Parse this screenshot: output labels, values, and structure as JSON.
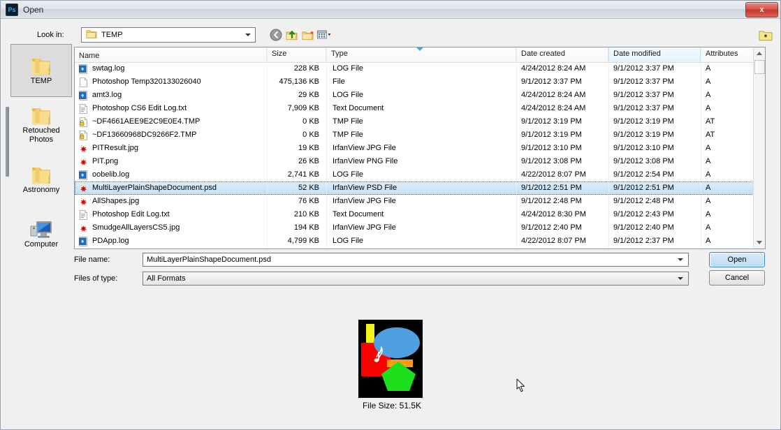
{
  "window": {
    "title": "Open",
    "app_icon": "photoshop-icon",
    "app_icon_text": "Ps",
    "close_label": "x"
  },
  "toolbar": {
    "lookin_label": "Look in:",
    "lookin_value": "TEMP",
    "buttons": [
      {
        "name": "back-button",
        "icon": "back-arrow-icon"
      },
      {
        "name": "up-folder-button",
        "icon": "up-folder-icon"
      },
      {
        "name": "new-folder-button",
        "icon": "new-folder-icon"
      },
      {
        "name": "views-button",
        "icon": "views-icon"
      }
    ],
    "favorites_icon": "favorite-folder-icon"
  },
  "places": {
    "items": [
      {
        "label": "TEMP",
        "icon": "folder-icon",
        "active": true
      },
      {
        "label": "Retouched\nPhotos",
        "icon": "folder-icon",
        "active": false
      },
      {
        "label": "Astronomy",
        "icon": "folder-icon",
        "active": false
      },
      {
        "label": "Computer",
        "icon": "computer-icon",
        "active": false
      }
    ]
  },
  "filelist": {
    "columns": [
      {
        "key": "name",
        "label": "Name",
        "sorted": false
      },
      {
        "key": "size",
        "label": "Size",
        "sorted": false
      },
      {
        "key": "type",
        "label": "Type",
        "sorted": false
      },
      {
        "key": "created",
        "label": "Date created",
        "sorted": false
      },
      {
        "key": "modified",
        "label": "Date modified",
        "sorted": true
      },
      {
        "key": "attributes",
        "label": "Attributes",
        "sorted": false
      }
    ],
    "sort_column": "Date modified",
    "sort_direction": "ascending",
    "rows": [
      {
        "icon": "log-file-icon",
        "name": "swtag.log",
        "size": "228 KB",
        "type": "LOG File",
        "created": "4/24/2012 8:24 AM",
        "modified": "9/1/2012 3:37 PM",
        "attributes": "A",
        "selected": false
      },
      {
        "icon": "blank-file-icon",
        "name": "Photoshop Temp320133026040",
        "size": "475,136 KB",
        "type": "File",
        "created": "9/1/2012 3:37 PM",
        "modified": "9/1/2012 3:37 PM",
        "attributes": "A",
        "selected": false
      },
      {
        "icon": "log-file-icon",
        "name": "amt3.log",
        "size": "29 KB",
        "type": "LOG File",
        "created": "4/24/2012 8:24 AM",
        "modified": "9/1/2012 3:37 PM",
        "attributes": "A",
        "selected": false
      },
      {
        "icon": "text-file-icon",
        "name": "Photoshop CS6 Edit Log.txt",
        "size": "7,909 KB",
        "type": "Text Document",
        "created": "4/24/2012 8:24 AM",
        "modified": "9/1/2012 3:37 PM",
        "attributes": "A",
        "selected": false
      },
      {
        "icon": "locked-file-icon",
        "name": "~DF4661AEE9E2C9E0E4.TMP",
        "size": "0 KB",
        "type": "TMP File",
        "created": "9/1/2012 3:19 PM",
        "modified": "9/1/2012 3:19 PM",
        "attributes": "AT",
        "selected": false
      },
      {
        "icon": "locked-file-icon",
        "name": "~DF13660968DC9266F2.TMP",
        "size": "0 KB",
        "type": "TMP File",
        "created": "9/1/2012 3:19 PM",
        "modified": "9/1/2012 3:19 PM",
        "attributes": "AT",
        "selected": false
      },
      {
        "icon": "irfanview-icon",
        "name": "PITResult.jpg",
        "size": "19 KB",
        "type": "IrfanView JPG File",
        "created": "9/1/2012 3:10 PM",
        "modified": "9/1/2012 3:10 PM",
        "attributes": "A",
        "selected": false
      },
      {
        "icon": "irfanview-icon",
        "name": "PIT.png",
        "size": "26 KB",
        "type": "IrfanView PNG File",
        "created": "9/1/2012 3:08 PM",
        "modified": "9/1/2012 3:08 PM",
        "attributes": "A",
        "selected": false
      },
      {
        "icon": "log-file-icon",
        "name": "oobelib.log",
        "size": "2,741 KB",
        "type": "LOG File",
        "created": "4/22/2012 8:07 PM",
        "modified": "9/1/2012 2:54 PM",
        "attributes": "A",
        "selected": false
      },
      {
        "icon": "irfanview-icon",
        "name": "MultiLayerPlainShapeDocument.psd",
        "size": "52 KB",
        "type": "IrfanView PSD File",
        "created": "9/1/2012 2:51 PM",
        "modified": "9/1/2012 2:51 PM",
        "attributes": "A",
        "selected": true
      },
      {
        "icon": "irfanview-icon",
        "name": "AllShapes.jpg",
        "size": "76 KB",
        "type": "IrfanView JPG File",
        "created": "9/1/2012 2:48 PM",
        "modified": "9/1/2012 2:48 PM",
        "attributes": "A",
        "selected": false
      },
      {
        "icon": "text-file-icon",
        "name": "Photoshop Edit Log.txt",
        "size": "210 KB",
        "type": "Text Document",
        "created": "4/24/2012 8:30 PM",
        "modified": "9/1/2012 2:43 PM",
        "attributes": "A",
        "selected": false
      },
      {
        "icon": "irfanview-icon",
        "name": "SmudgeAllLayersCS5.jpg",
        "size": "194 KB",
        "type": "IrfanView JPG File",
        "created": "9/1/2012 2:40 PM",
        "modified": "9/1/2012 2:40 PM",
        "attributes": "A",
        "selected": false
      },
      {
        "icon": "log-file-icon",
        "name": "PDApp.log",
        "size": "4,799 KB",
        "type": "LOG File",
        "created": "4/22/2012 8:07 PM",
        "modified": "9/1/2012 2:37 PM",
        "attributes": "A",
        "selected": false
      }
    ]
  },
  "form": {
    "filename_label": "File name:",
    "filename_value": "MultiLayerPlainShapeDocument.psd",
    "filetype_label": "Files of type:",
    "filetype_value": "All Formats",
    "open_label": "Open",
    "cancel_label": "Cancel"
  },
  "preview": {
    "file_size_label": "File Size: 51.5K",
    "background": "#000000",
    "shapes": [
      {
        "name": "yellow-rectangle",
        "color": "#f2f21e"
      },
      {
        "name": "red-square",
        "color": "#fc0000"
      },
      {
        "name": "blue-ellipse",
        "color": "#4f9fe0"
      },
      {
        "name": "orange-rectangle",
        "color": "#fd9a16"
      },
      {
        "name": "green-pentagon",
        "color": "#1ce01c"
      },
      {
        "name": "white-music-note",
        "color": "#ffffff"
      }
    ]
  },
  "colors": {
    "selection": "#cfe6f8",
    "accent": "#3c7fb1",
    "dialog_bg": "#f0f0f0"
  }
}
